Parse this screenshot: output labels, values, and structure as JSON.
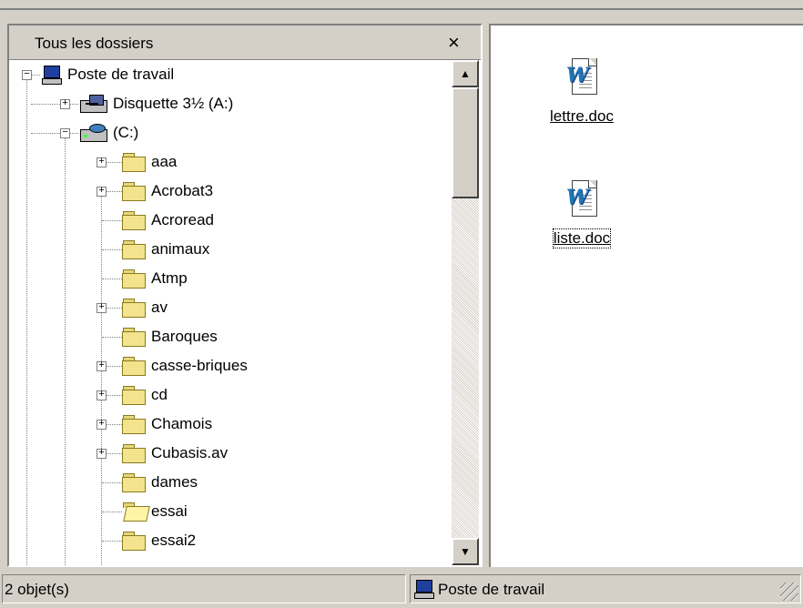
{
  "left_panel": {
    "title": "Tous les dossiers",
    "close_label": "×"
  },
  "tree": {
    "root": {
      "label": "Poste de travail"
    },
    "floppy": {
      "label": "Disquette 3½ (A:)"
    },
    "drive_c": {
      "label": "(C:)"
    },
    "folders": [
      {
        "label": "aaa",
        "expandable": true
      },
      {
        "label": "Acrobat3",
        "expandable": true
      },
      {
        "label": "Acroread",
        "expandable": false
      },
      {
        "label": "animaux",
        "expandable": false
      },
      {
        "label": "Atmp",
        "expandable": false
      },
      {
        "label": "av",
        "expandable": true
      },
      {
        "label": "Baroques",
        "expandable": false
      },
      {
        "label": "casse-briques",
        "expandable": true
      },
      {
        "label": "cd",
        "expandable": true
      },
      {
        "label": "Chamois",
        "expandable": true
      },
      {
        "label": "Cubasis.av",
        "expandable": true
      },
      {
        "label": "dames",
        "expandable": false
      },
      {
        "label": "essai",
        "expandable": false,
        "open": true
      },
      {
        "label": "essai2",
        "expandable": false
      }
    ]
  },
  "files": [
    {
      "name": "lettre.doc",
      "selected": false
    },
    {
      "name": "liste.doc",
      "selected": true
    }
  ],
  "status_bar": {
    "count": "2 objet(s)",
    "location": "Poste de travail"
  }
}
